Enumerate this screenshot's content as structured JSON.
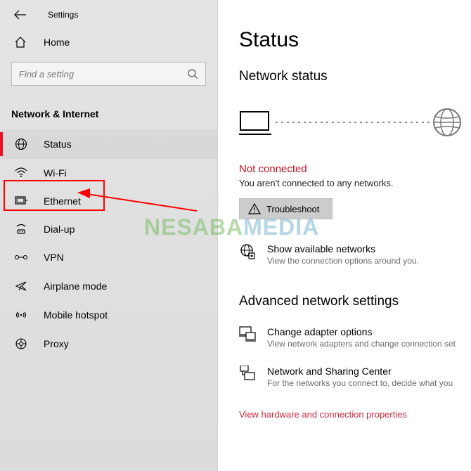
{
  "header": {
    "settings_label": "Settings"
  },
  "sidebar": {
    "home_label": "Home",
    "search_placeholder": "Find a setting",
    "section_heading": "Network & Internet",
    "items": [
      {
        "label": "Status"
      },
      {
        "label": "Wi-Fi"
      },
      {
        "label": "Ethernet"
      },
      {
        "label": "Dial-up"
      },
      {
        "label": "VPN"
      },
      {
        "label": "Airplane mode"
      },
      {
        "label": "Mobile hotspot"
      },
      {
        "label": "Proxy"
      }
    ]
  },
  "main": {
    "page_title": "Status",
    "network_status_heading": "Network status",
    "not_connected_title": "Not connected",
    "not_connected_desc": "You aren't connected to any networks.",
    "troubleshoot_label": "Troubleshoot",
    "show_networks_title": "Show available networks",
    "show_networks_desc": "View the connection options around you.",
    "advanced_heading": "Advanced network settings",
    "adapter_title": "Change adapter options",
    "adapter_desc": "View network adapters and change connection set",
    "sharing_title": "Network and Sharing Center",
    "sharing_desc": "For the networks you connect to, decide what you",
    "view_hw_link": "View hardware and connection properties"
  },
  "watermark": {
    "part1": "NESABA",
    "part2": "MEDIA"
  }
}
